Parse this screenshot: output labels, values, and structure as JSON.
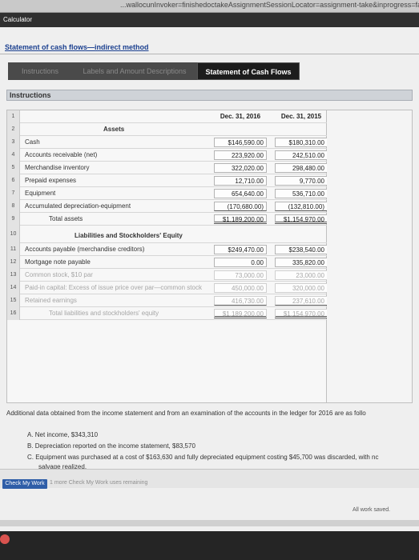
{
  "browser": {
    "url": "...wallocunInvoker=finishedoctakeAssignmentSessionLocator=assignment-take&inprogress=false"
  },
  "app": {
    "calculator_label": "Calculator"
  },
  "panel": {
    "title": "Statement of cash flows—indirect method",
    "tabs": [
      {
        "label": "Instructions"
      },
      {
        "label": "Labels and Amount Descriptions"
      },
      {
        "label": "Statement of Cash Flows"
      }
    ],
    "instructions_label": "Instructions"
  },
  "sheet": {
    "col1_header": "Dec. 31, 2016",
    "col2_header": "Dec. 31, 2015",
    "rows": [
      {
        "n": "1",
        "label": "",
        "v1": "",
        "v2": ""
      },
      {
        "n": "2",
        "label": "Assets",
        "v1": "",
        "v2": ""
      },
      {
        "n": "3",
        "label": "Cash",
        "v1": "$146,590.00",
        "v2": "$180,310.00"
      },
      {
        "n": "4",
        "label": "Accounts receivable (net)",
        "v1": "223,920.00",
        "v2": "242,510.00"
      },
      {
        "n": "5",
        "label": "Merchandise inventory",
        "v1": "322,020.00",
        "v2": "298,480.00"
      },
      {
        "n": "6",
        "label": "Prepaid expenses",
        "v1": "12,710.00",
        "v2": "9,770.00"
      },
      {
        "n": "7",
        "label": "Equipment",
        "v1": "654,640.00",
        "v2": "536,710.00"
      },
      {
        "n": "8",
        "label": "Accumulated depreciation-equipment",
        "v1": "(170,680.00)",
        "v2": "(132,810.00)"
      },
      {
        "n": "9",
        "label": "Total assets",
        "v1": "$1,189,200.00",
        "v2": "$1,154,970.00"
      },
      {
        "n": "10",
        "label": "Liabilities and Stockholders' Equity",
        "v1": "",
        "v2": ""
      },
      {
        "n": "11",
        "label": "Accounts payable (merchandise creditors)",
        "v1": "$249,470.00",
        "v2": "$238,540.00"
      },
      {
        "n": "12",
        "label": "Mortgage note payable",
        "v1": "0.00",
        "v2": "335,820.00"
      },
      {
        "n": "13",
        "label": "Common stock, $10 par",
        "v1": "73,000.00",
        "v2": "23,000.00"
      },
      {
        "n": "14",
        "label": "Paid-in capital: Excess of issue price over par—common stock",
        "v1": "450,000.00",
        "v2": "320,000.00"
      },
      {
        "n": "15",
        "label": "Retained earnings",
        "v1": "416,730.00",
        "v2": "237,610.00"
      },
      {
        "n": "16",
        "label": "Total liabilities and stockholders' equity",
        "v1": "$1,189,200.00",
        "v2": "$1,154,970.00"
      }
    ]
  },
  "additional": {
    "intro": "Additional data obtained from the income statement and from an examination of the accounts in the ledger for 2016 are as follo",
    "items": [
      "A.  Net income, $343,310",
      "B.  Depreciation reported on the income statement, $83,570",
      "C.  Equipment was purchased at a cost of $163,630 and fully depreciated equipment costing $45,700 was discarded, with nc"
    ],
    "item_c_cont": "salvage realized."
  },
  "footer": {
    "check_button": "Check My Work",
    "more_text": "1 more Check My Work uses remaining",
    "saved_text": "All work saved."
  },
  "progress": {
    "fraction": 0.0
  },
  "colors": {
    "accent": "#2f5ea8",
    "title": "#1a3f8f"
  }
}
